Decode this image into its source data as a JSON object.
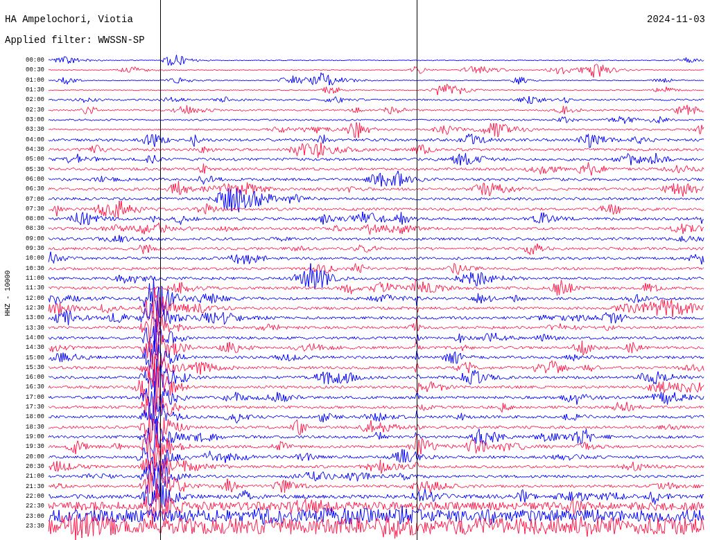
{
  "header": {
    "station": "HA Ampelochori, Viotia",
    "date": "2024-11-03",
    "filter": "Applied filter: WWSSN-SP"
  },
  "axis_label": "HHZ - 10000",
  "rows": [
    {
      "time": "00:00",
      "color": "#0000ff"
    },
    {
      "time": "00:30",
      "color": "#ff1a4b"
    },
    {
      "time": "01:00",
      "color": "#0000ff"
    },
    {
      "time": "01:30",
      "color": "#ff1a4b"
    },
    {
      "time": "02:00",
      "color": "#0000ff"
    },
    {
      "time": "02:30",
      "color": "#ff1a4b"
    },
    {
      "time": "03:00",
      "color": "#0000ff"
    },
    {
      "time": "03:30",
      "color": "#ff1a4b"
    },
    {
      "time": "04:00",
      "color": "#0000ff"
    },
    {
      "time": "04:30",
      "color": "#ff1a4b"
    },
    {
      "time": "05:00",
      "color": "#0000ff"
    },
    {
      "time": "05:30",
      "color": "#ff1a4b"
    },
    {
      "time": "06:00",
      "color": "#0000ff"
    },
    {
      "time": "06:30",
      "color": "#ff1a4b"
    },
    {
      "time": "07:00",
      "color": "#0000ff"
    },
    {
      "time": "07:30",
      "color": "#ff1a4b"
    },
    {
      "time": "08:00",
      "color": "#0000ff"
    },
    {
      "time": "08:30",
      "color": "#ff1a4b"
    },
    {
      "time": "09:00",
      "color": "#0000ff"
    },
    {
      "time": "09:30",
      "color": "#ff1a4b"
    },
    {
      "time": "10:00",
      "color": "#0000ff"
    },
    {
      "time": "10:30",
      "color": "#ff1a4b"
    },
    {
      "time": "11:00",
      "color": "#0000ff"
    },
    {
      "time": "11:30",
      "color": "#ff1a4b"
    },
    {
      "time": "12:00",
      "color": "#0000ff"
    },
    {
      "time": "12:30",
      "color": "#ff1a4b"
    },
    {
      "time": "13:00",
      "color": "#0000ff"
    },
    {
      "time": "13:30",
      "color": "#ff1a4b"
    },
    {
      "time": "14:00",
      "color": "#0000ff"
    },
    {
      "time": "14:30",
      "color": "#ff1a4b"
    },
    {
      "time": "15:00",
      "color": "#0000ff"
    },
    {
      "time": "15:30",
      "color": "#ff1a4b"
    },
    {
      "time": "16:00",
      "color": "#0000ff"
    },
    {
      "time": "16:30",
      "color": "#ff1a4b"
    },
    {
      "time": "17:00",
      "color": "#0000ff"
    },
    {
      "time": "17:30",
      "color": "#ff1a4b"
    },
    {
      "time": "18:00",
      "color": "#0000ff"
    },
    {
      "time": "18:30",
      "color": "#ff1a4b"
    },
    {
      "time": "19:00",
      "color": "#0000ff"
    },
    {
      "time": "19:30",
      "color": "#ff1a4b"
    },
    {
      "time": "20:00",
      "color": "#0000ff"
    },
    {
      "time": "20:30",
      "color": "#ff1a4b"
    },
    {
      "time": "21:00",
      "color": "#0000ff"
    },
    {
      "time": "21:30",
      "color": "#ff1a4b"
    },
    {
      "time": "22:00",
      "color": "#0000ff"
    },
    {
      "time": "22:30",
      "color": "#ff1a4b"
    },
    {
      "time": "23:00",
      "color": "#0000ff"
    },
    {
      "time": "23:30",
      "color": "#ff1a4b"
    }
  ]
}
